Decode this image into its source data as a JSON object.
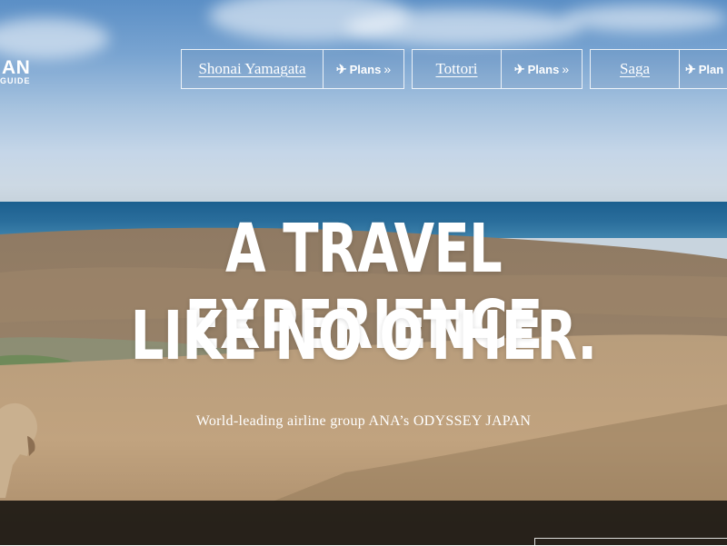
{
  "logo": {
    "title": "AN",
    "subtitle": "GUIDE"
  },
  "destinations": [
    {
      "name": "Shonai Yamagata",
      "plans_label": "Plans",
      "icon": "plane-icon",
      "arrow": "»"
    },
    {
      "name": "Tottori",
      "plans_label": "Plans",
      "icon": "plane-icon",
      "arrow": "»"
    },
    {
      "name": "Saga",
      "plans_label": "Plan",
      "icon": "plane-icon",
      "arrow": "»"
    }
  ],
  "hero": {
    "headline_line1": "A TRAVEL EXPERIENCE",
    "headline_line2": "LIKE NO OTHER.",
    "subheading": "World-leading airline group ANA’s ODYSSEY JAPAN"
  },
  "colors": {
    "sky": "#7aa6d2",
    "sea": "#1c5f8f",
    "sand": "#b79a76",
    "text": "#ffffff",
    "bar": "#14120f"
  }
}
